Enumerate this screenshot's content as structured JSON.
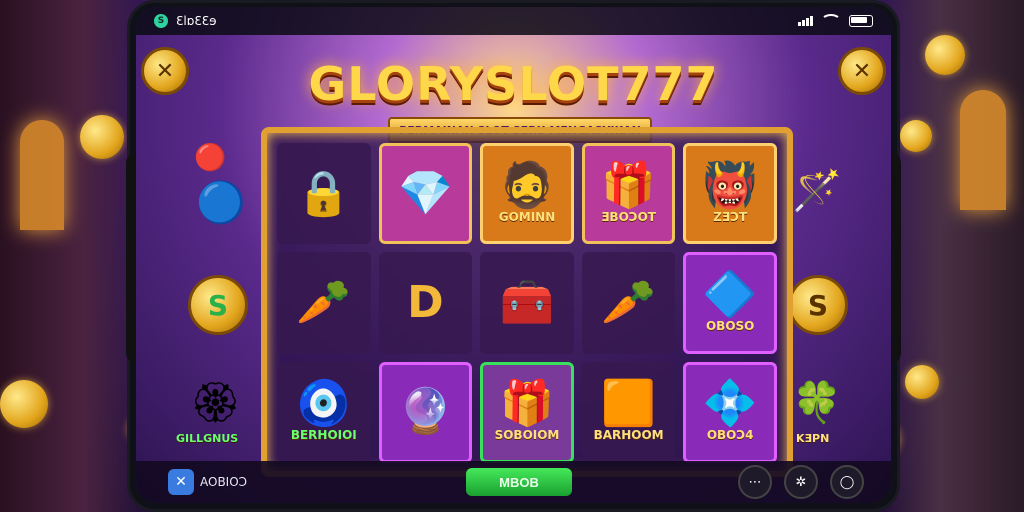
{
  "status": {
    "app_name": "ƐlɒƐƐɘ",
    "logo_glyph": "S"
  },
  "title": "GLORYSLOT777",
  "subtitle": "PERMAINAN SLOT SERU MENGASYIKAN",
  "corner_buttons": {
    "left_glyph": "✕",
    "right_glyph": "✕"
  },
  "tiles": [
    {
      "icon": "gold-lock-icon",
      "glyph": "🔒",
      "label": ""
    },
    {
      "icon": "blue-gem-icon",
      "glyph": "💎",
      "label": ""
    },
    {
      "icon": "bearded-man-icon",
      "glyph": "🧔",
      "label": "GOMINN"
    },
    {
      "icon": "purple-gem-box-icon",
      "glyph": "🎁",
      "label": "ƎBOƆOT"
    },
    {
      "icon": "viking-warrior-icon",
      "glyph": "👹",
      "label": "ZƎƆT"
    },
    {
      "icon": "red-carrot-icon",
      "glyph": "🥕",
      "label": ""
    },
    {
      "icon": "gold-letter-d-icon",
      "glyph": "D",
      "label": ""
    },
    {
      "icon": "gold-chest-icon",
      "glyph": "🧰",
      "label": ""
    },
    {
      "icon": "gold-carrot-icon",
      "glyph": "🥕",
      "label": ""
    },
    {
      "icon": "blue-crystal-icon",
      "glyph": "🔷",
      "label": "OBOSO"
    },
    {
      "icon": "blue-amulet-icon",
      "glyph": "🧿",
      "label": "BERHOIOI"
    },
    {
      "icon": "purple-gem-icon",
      "glyph": "🔮",
      "label": ""
    },
    {
      "icon": "treasure-chest-icon",
      "glyph": "🎁",
      "label": "SOBOIOM"
    },
    {
      "icon": "gold-bars-icon",
      "glyph": "🟧",
      "label": "BARHOOM"
    },
    {
      "icon": "blue-diamond-icon",
      "glyph": "💠",
      "label": "OBOƆ4"
    }
  ],
  "side_symbols": {
    "left_top": {
      "icon": "red-gem-icon",
      "glyph": "🔴"
    },
    "left_mid": {
      "icon": "blue-oval-gem-icon",
      "glyph": "🔵"
    },
    "left_coin": {
      "icon": "dollar-coin-icon",
      "glyph": "S"
    },
    "left_bottom": {
      "icon": "red-jewel-icon",
      "glyph": "🏵",
      "label": "GILLGNUS"
    },
    "right_top": {
      "icon": "magic-wand-icon",
      "glyph": "🪄"
    },
    "right_coin": {
      "icon": "dollar-coin-icon",
      "glyph": "S"
    },
    "right_bottom": {
      "icon": "clover-coin-icon",
      "glyph": "🍀",
      "label": "KƎPN"
    }
  },
  "bottombar": {
    "app_label": "AOBIOƆ",
    "play_label": "MBOB",
    "round_glyphs": [
      "⋯",
      "✲",
      "◯"
    ]
  },
  "colors": {
    "accent_gold": "#e1a132",
    "play_green": "#2fbf3f",
    "title_yellow": "#ffd84a"
  }
}
